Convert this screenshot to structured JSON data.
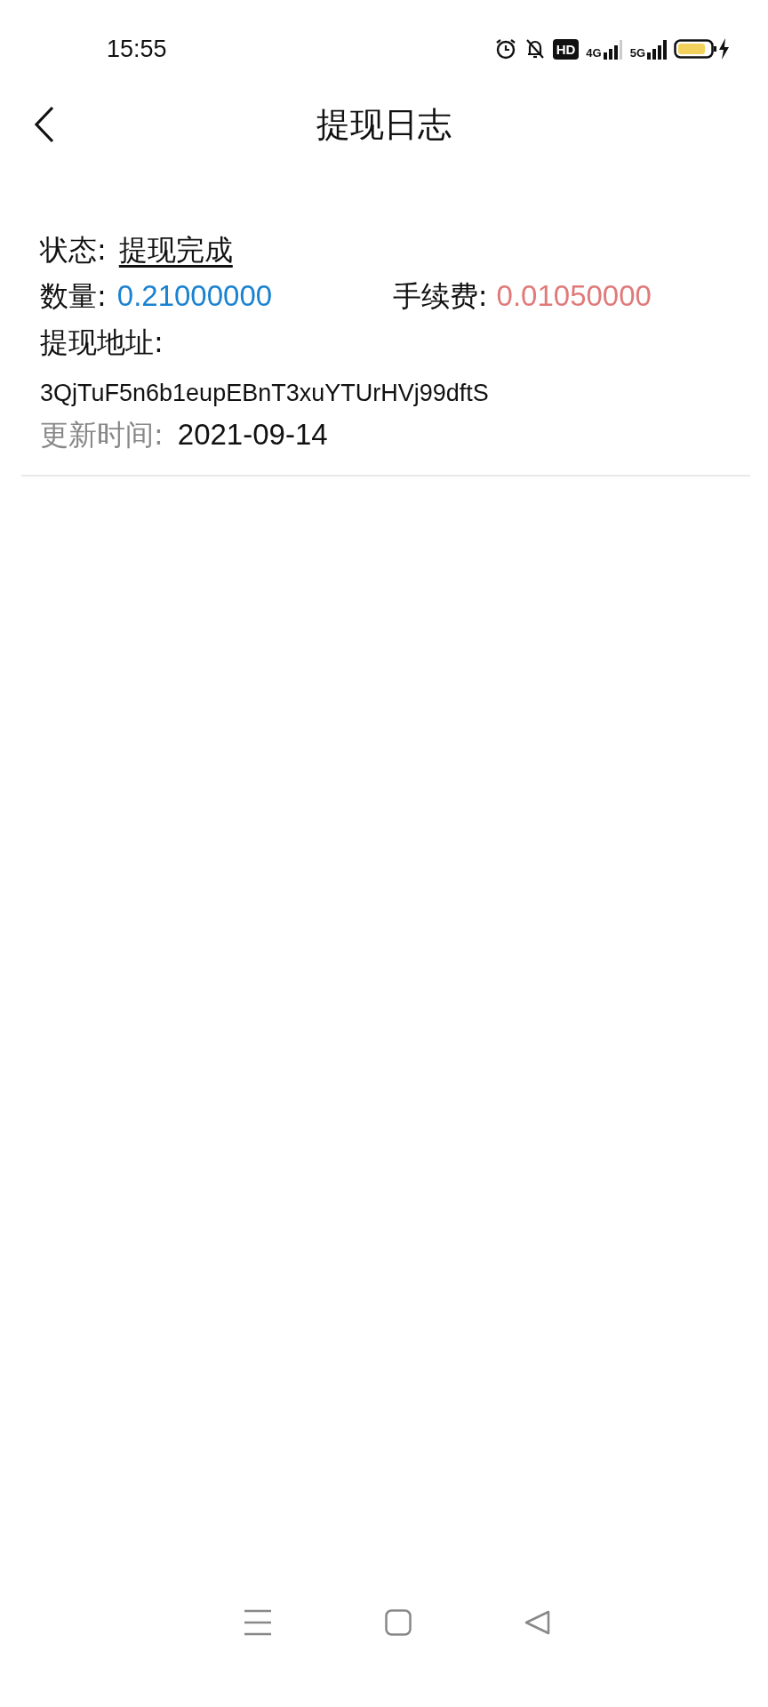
{
  "status_bar": {
    "time": "15:55",
    "hd_badge": "HD",
    "net_4g": "4G",
    "net_5g": "5G"
  },
  "header": {
    "title": "提现日志"
  },
  "record": {
    "status_label": "状态:",
    "status_value": "提现完成",
    "amount_label": "数量:",
    "amount_value": "0.21000000",
    "fee_label": "手续费:",
    "fee_value": "0.01050000",
    "address_label": "提现地址:",
    "address_value": "3QjTuF5n6b1eupEBnT3xuYTUrHVj99dftS",
    "updated_label": "更新时间:",
    "updated_value": "2021-09-14"
  }
}
